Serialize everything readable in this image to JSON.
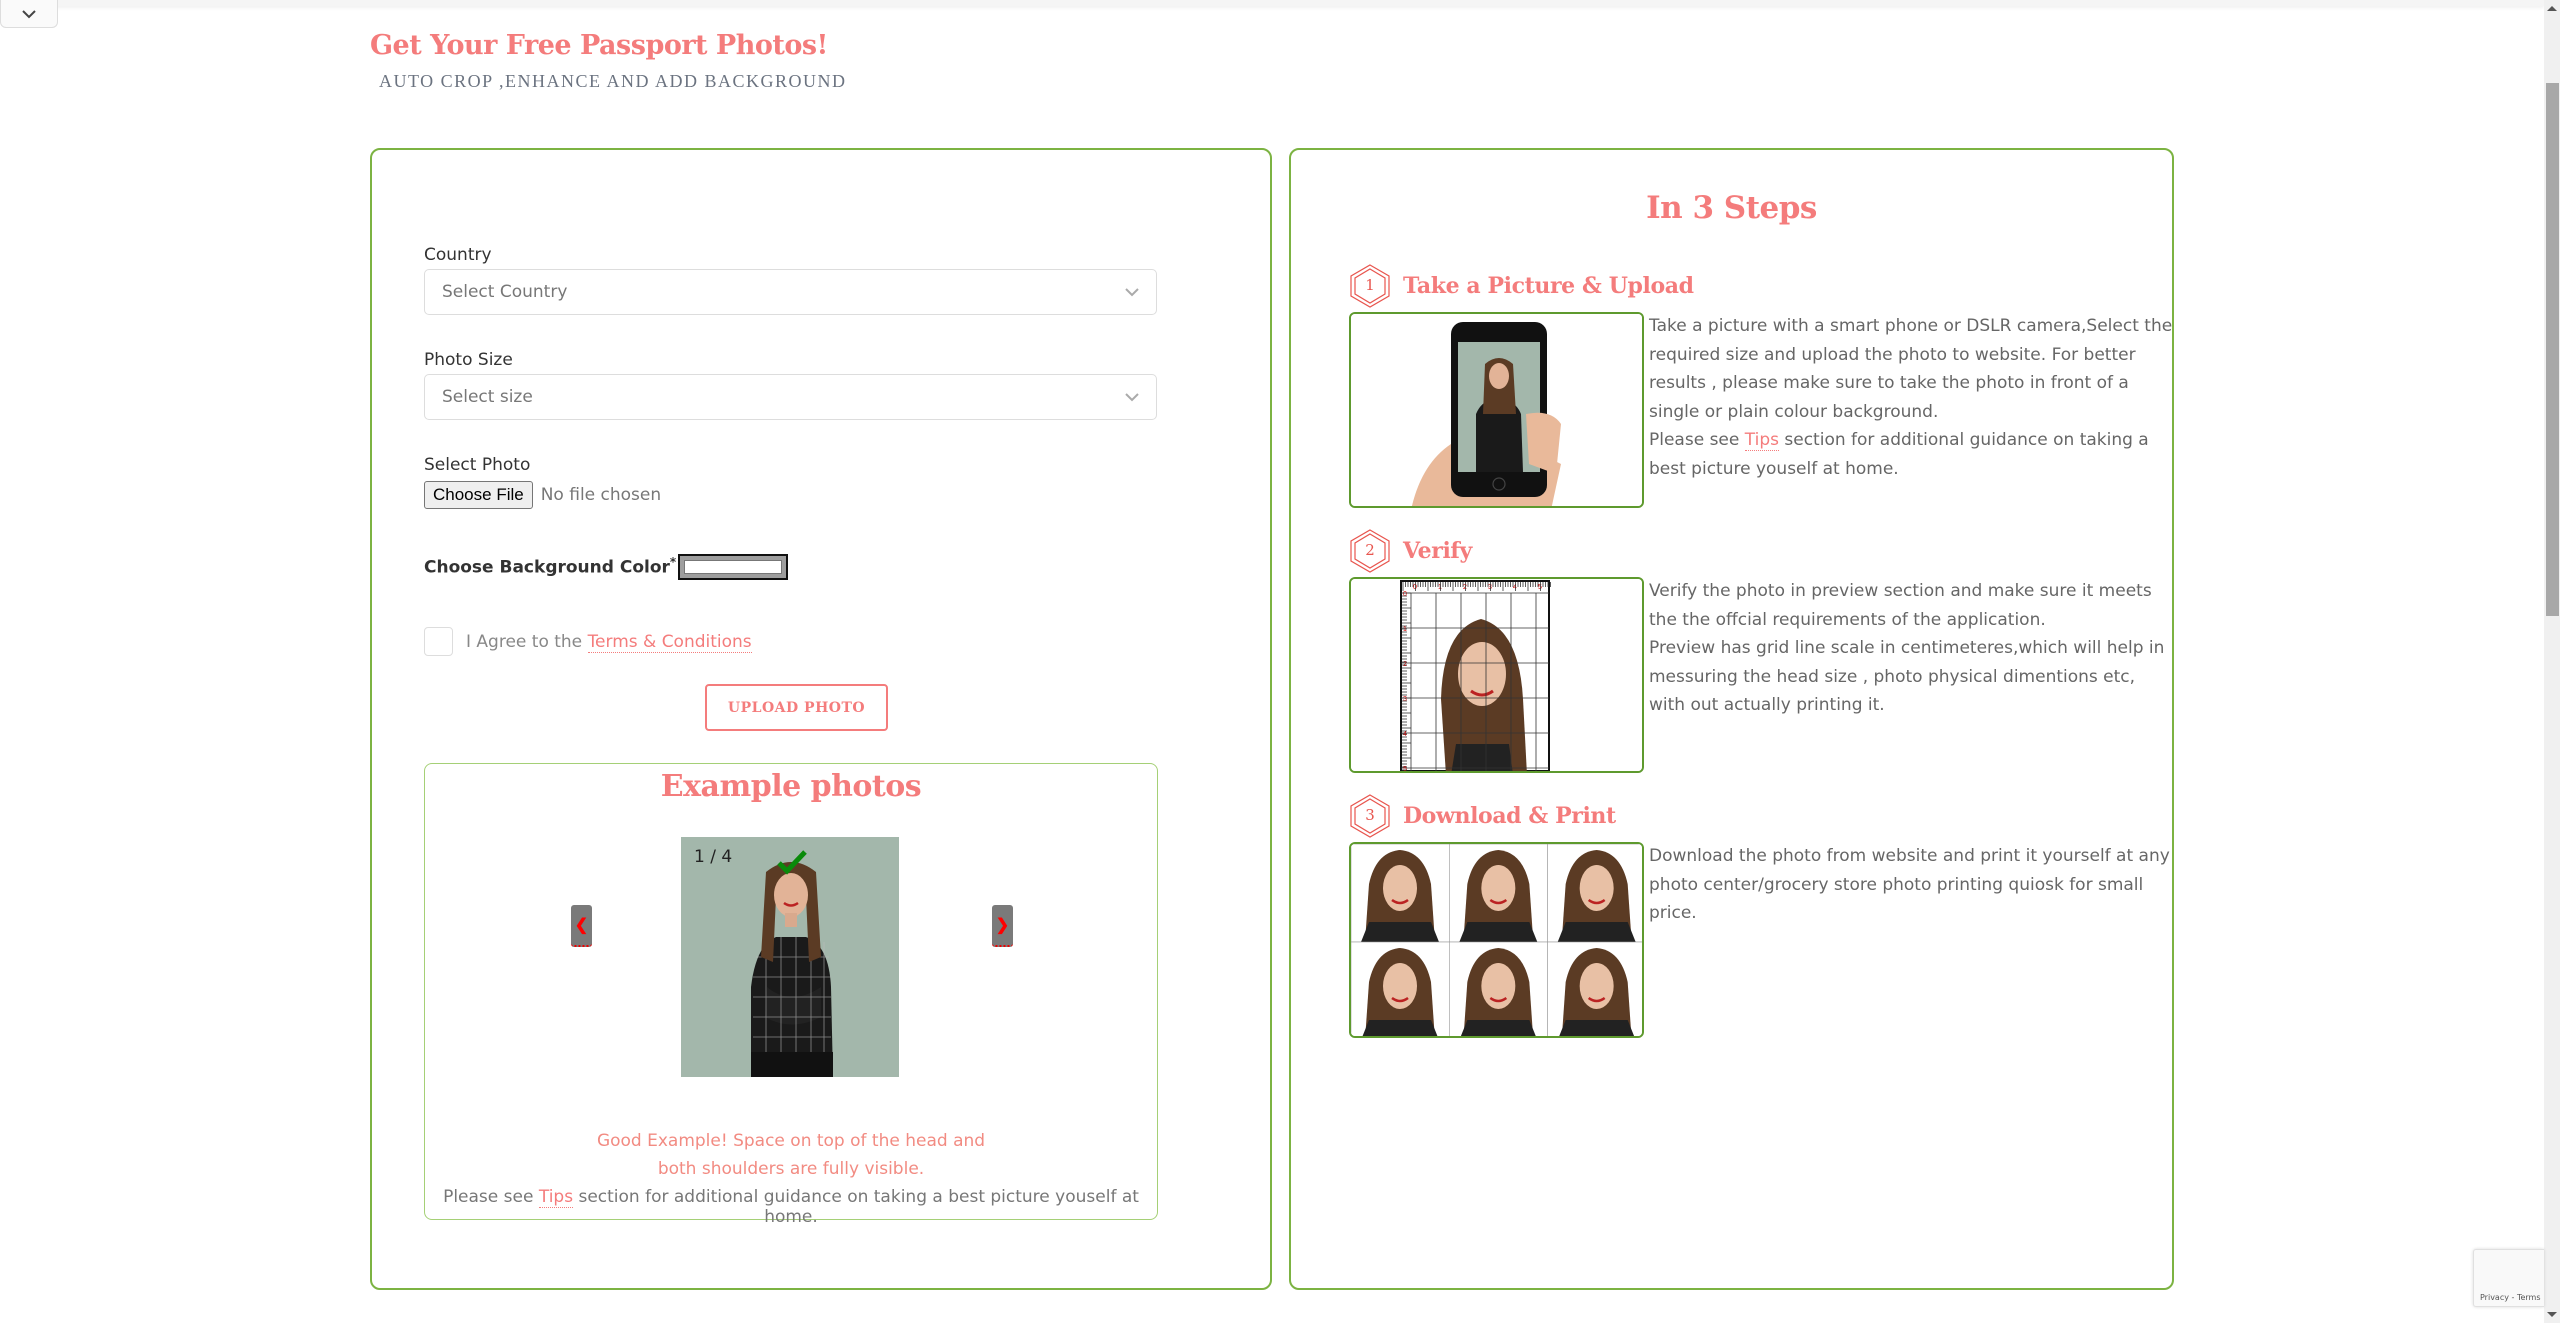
{
  "header": {
    "title": "Get Your Free Passport Photos!",
    "subtitle": "AUTO CROP ,ENHANCE AND ADD BACKGROUND"
  },
  "icons": {
    "collapse": "chevron-down-icon",
    "select_chevron": "chevron-down-icon",
    "check": "checkmark-icon",
    "prev": "chevron-left-icon",
    "next": "chevron-right-icon",
    "step_badge": "hexagon-icon"
  },
  "colors": {
    "accent": "#f47c7c",
    "panel_border": "#7cb342",
    "check_green": "#0a8a0a",
    "nav_arrow": "#ff0000"
  },
  "form": {
    "country_label": "Country",
    "country_placeholder": "Select Country",
    "size_label": "Photo Size",
    "size_placeholder": "Select size",
    "photo_label": "Select Photo",
    "choose_file_label": "Choose File",
    "file_status": "No file chosen",
    "bg_color_label": "Choose Background Color",
    "bg_color_required": "*",
    "bg_color_colon": " :",
    "bg_color_value": "#ffffff",
    "agree_prefix": "I Agree to the ",
    "agree_link": "Terms & Conditions",
    "agree_checked": false,
    "upload_label": "UPLOAD PHOTO"
  },
  "examples": {
    "title": "Example photos",
    "counter": "1 / 4",
    "prev_label": "❮",
    "next_label": "❯",
    "caption": "Good Example! Space on top of the head and both shoulders are fully visible.",
    "tips_prefix": "Please see ",
    "tips_link": "Tips",
    "tips_suffix": " section for additional guidance on taking a best picture youself at home."
  },
  "steps": {
    "title": "In 3 Steps",
    "items": [
      {
        "number": "1",
        "title": "Take a Picture & Upload",
        "text": "Take a picture with a smart phone or DSLR camera,Select the required size and upload the photo to website. For better results , please make sure to take the photo in front of a single or plain colour background.",
        "tips_prefix": "Please see ",
        "tips_link": "Tips",
        "tips_suffix": " section for additional guidance on taking a best picture youself at home."
      },
      {
        "number": "2",
        "title": "Verify",
        "text": "Verify the photo in preview section and make sure it meets the the offcial requirements of the application.",
        "text2": "Preview has grid line scale in centimeteres,which will help in messuring the head size , photo physical dimentions etc, with out actually printing it.",
        "ruler_ticks": [
          "0",
          "1",
          "2",
          "3",
          "4",
          "5"
        ]
      },
      {
        "number": "3",
        "title": "Download & Print",
        "text": "Download the photo from website and print it yourself at any photo center/grocery store photo printing quiosk for small price."
      }
    ]
  },
  "recaptcha": {
    "links": "Privacy - Terms"
  }
}
